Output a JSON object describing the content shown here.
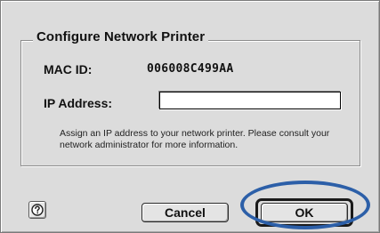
{
  "dialog": {
    "group_title": "Configure Network Printer",
    "mac_label": "MAC ID:",
    "mac_value": "006008C499AA",
    "ip_label": "IP Address:",
    "ip_value": "",
    "note": "Assign an IP address to your network printer. Please consult your network administrator for more information."
  },
  "buttons": {
    "help_icon": "question-mark-icon",
    "cancel_label": "Cancel",
    "ok_label": "OK"
  },
  "colors": {
    "dialog_bg": "#dcdcdc",
    "highlight_ring": "#2c5fa8"
  }
}
